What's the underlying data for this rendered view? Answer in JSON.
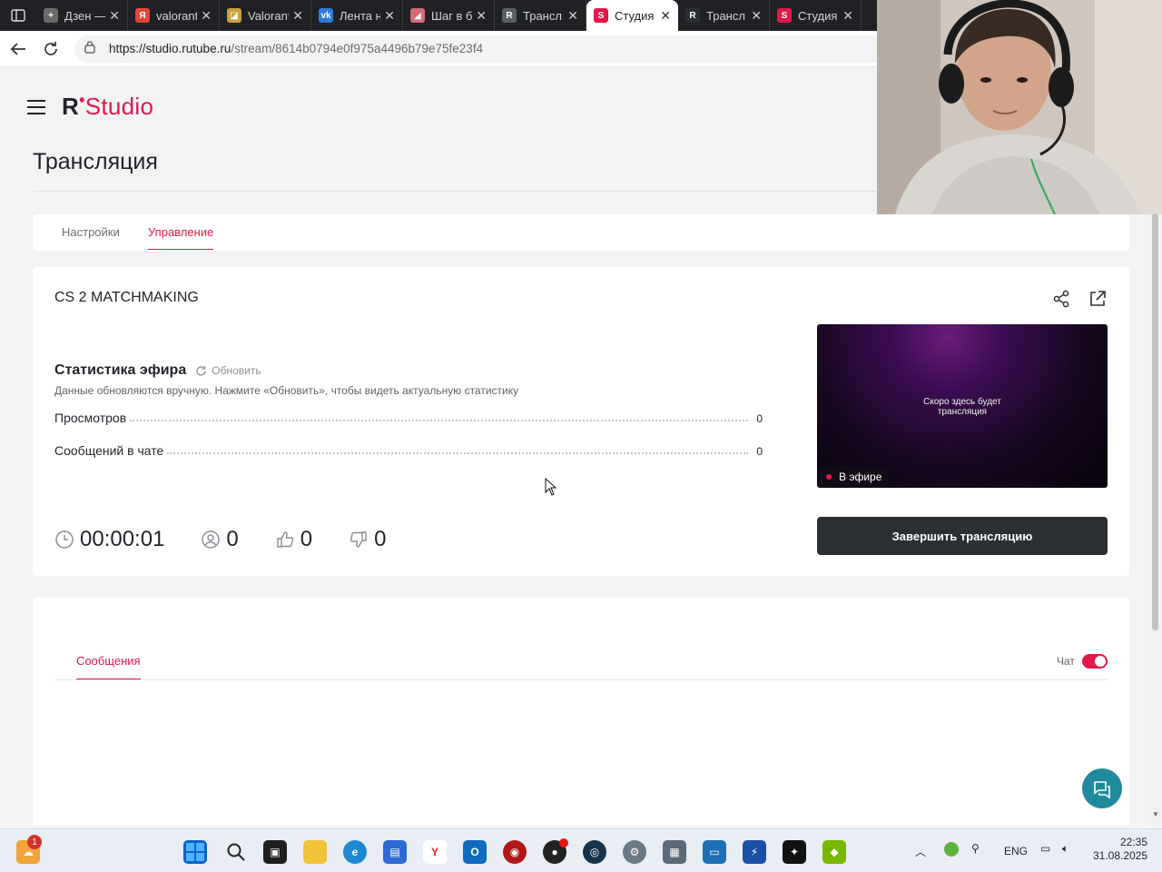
{
  "browser": {
    "tabs": [
      {
        "title": "Дзен —",
        "fav_color": "#6a6a6a",
        "fav_text": "+"
      },
      {
        "title": "valorant",
        "fav_color": "#e2463a",
        "fav_text": "Я"
      },
      {
        "title": "Valorant",
        "fav_color": "#c7a23c",
        "fav_text": "◪"
      },
      {
        "title": "Лента н",
        "fav_color": "#2d7bd8",
        "fav_text": "vk"
      },
      {
        "title": "Шаг в б",
        "fav_color": "#d66b7a",
        "fav_text": "◢"
      },
      {
        "title": "Трансл",
        "fav_color": "#5a5f66",
        "fav_text": "R"
      },
      {
        "title": "Студия",
        "fav_color": "#e3184a",
        "fav_text": "S",
        "active": true
      },
      {
        "title": "Трансл",
        "fav_color": "#2a2f36",
        "fav_text": "R"
      },
      {
        "title": "Студия",
        "fav_color": "#e3184a",
        "fav_text": "S"
      }
    ],
    "url_host": "https://studio.rutube.ru",
    "url_path": "/stream/8614b0794e0f975a4496b79e75fe23f4"
  },
  "header": {
    "logo_r": "R",
    "logo_dot": "•",
    "logo_studio": "Studio"
  },
  "page_title": "Трансляция",
  "page_tabs": {
    "settings": "Настройки",
    "control": "Управление"
  },
  "stream": {
    "name": "CS 2 MATCHMAKING",
    "stats_title": "Статистика эфира",
    "refresh_label": "Обновить",
    "stats_note": "Данные обновляются вручную. Нажмите «Обновить», чтобы видеть актуальную статистику",
    "views_label": "Просмотров",
    "views_value": "0",
    "chat_label": "Сообщений в чате",
    "chat_value": "0",
    "duration": "00:00:01",
    "viewers": "0",
    "likes": "0",
    "dislikes": "0",
    "preview_text_1": "Скоро здесь будет",
    "preview_text_2": "трансляция",
    "live_label": "В эфире",
    "end_button": "Завершить трансляцию"
  },
  "messages": {
    "tab_label": "Сообщения",
    "chat_toggle_label": "Чат",
    "chat_enabled": true
  },
  "taskbar": {
    "weather_badge": "1",
    "lang": "ENG",
    "time": "22:35",
    "date": "31.08.2025"
  },
  "colors": {
    "accent": "#e3184a",
    "dark_button": "#2b3034",
    "help_button": "#1f8a9e"
  }
}
